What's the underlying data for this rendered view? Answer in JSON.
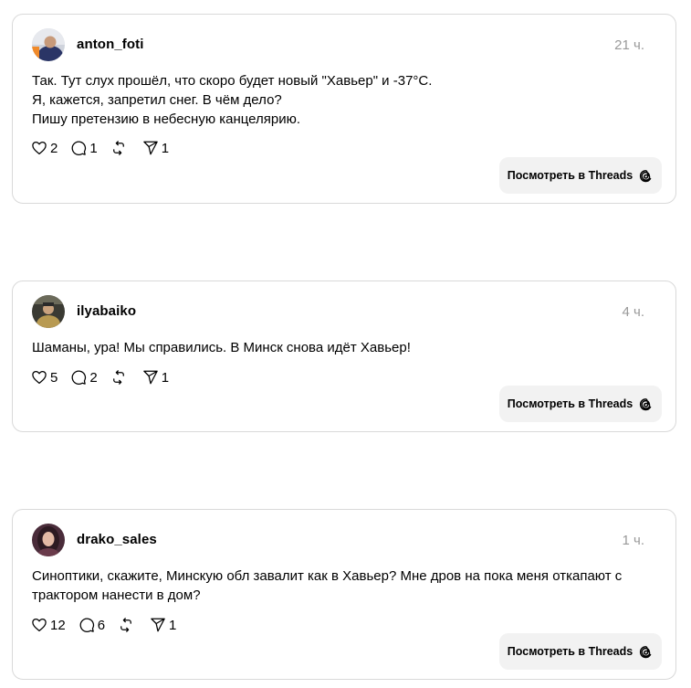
{
  "posts": [
    {
      "username": "anton_foti",
      "time": "21 ч.",
      "text": "Так. Тут слух прошёл, что скоро будет новый \"Хавьер\" и -37°C.\nЯ, кажется, запретил снег. В чём дело?\nПишу претензию в небесную канцелярию.",
      "likes": "2",
      "replies": "1",
      "reposts": "",
      "shares": "1",
      "button_label": "Посмотреть в Threads"
    },
    {
      "username": "ilyabaiko",
      "time": "4 ч.",
      "text": "Шаманы, ура! Мы справились. В Минск снова идёт Хавьер!",
      "likes": "5",
      "replies": "2",
      "reposts": "",
      "shares": "1",
      "button_label": "Посмотреть в Threads"
    },
    {
      "username": "drako_sales",
      "time": "1 ч.",
      "text": "Синоптики, скажите, Минскую обл завалит как в Хавьер? Мне дров на пока меня откапают с\nтрактором нанести в дом?",
      "likes": "12",
      "replies": "6",
      "reposts": "",
      "shares": "1",
      "button_label": "Посмотреть в Threads"
    }
  ],
  "icons": {
    "like": "heart-icon",
    "reply": "comment-icon",
    "repost": "repost-icon",
    "share": "send-icon",
    "threads": "threads-logo-icon"
  },
  "colors": {
    "border": "#d9d9d9",
    "muted_text": "#999999",
    "button_bg": "#f2f2f2"
  }
}
